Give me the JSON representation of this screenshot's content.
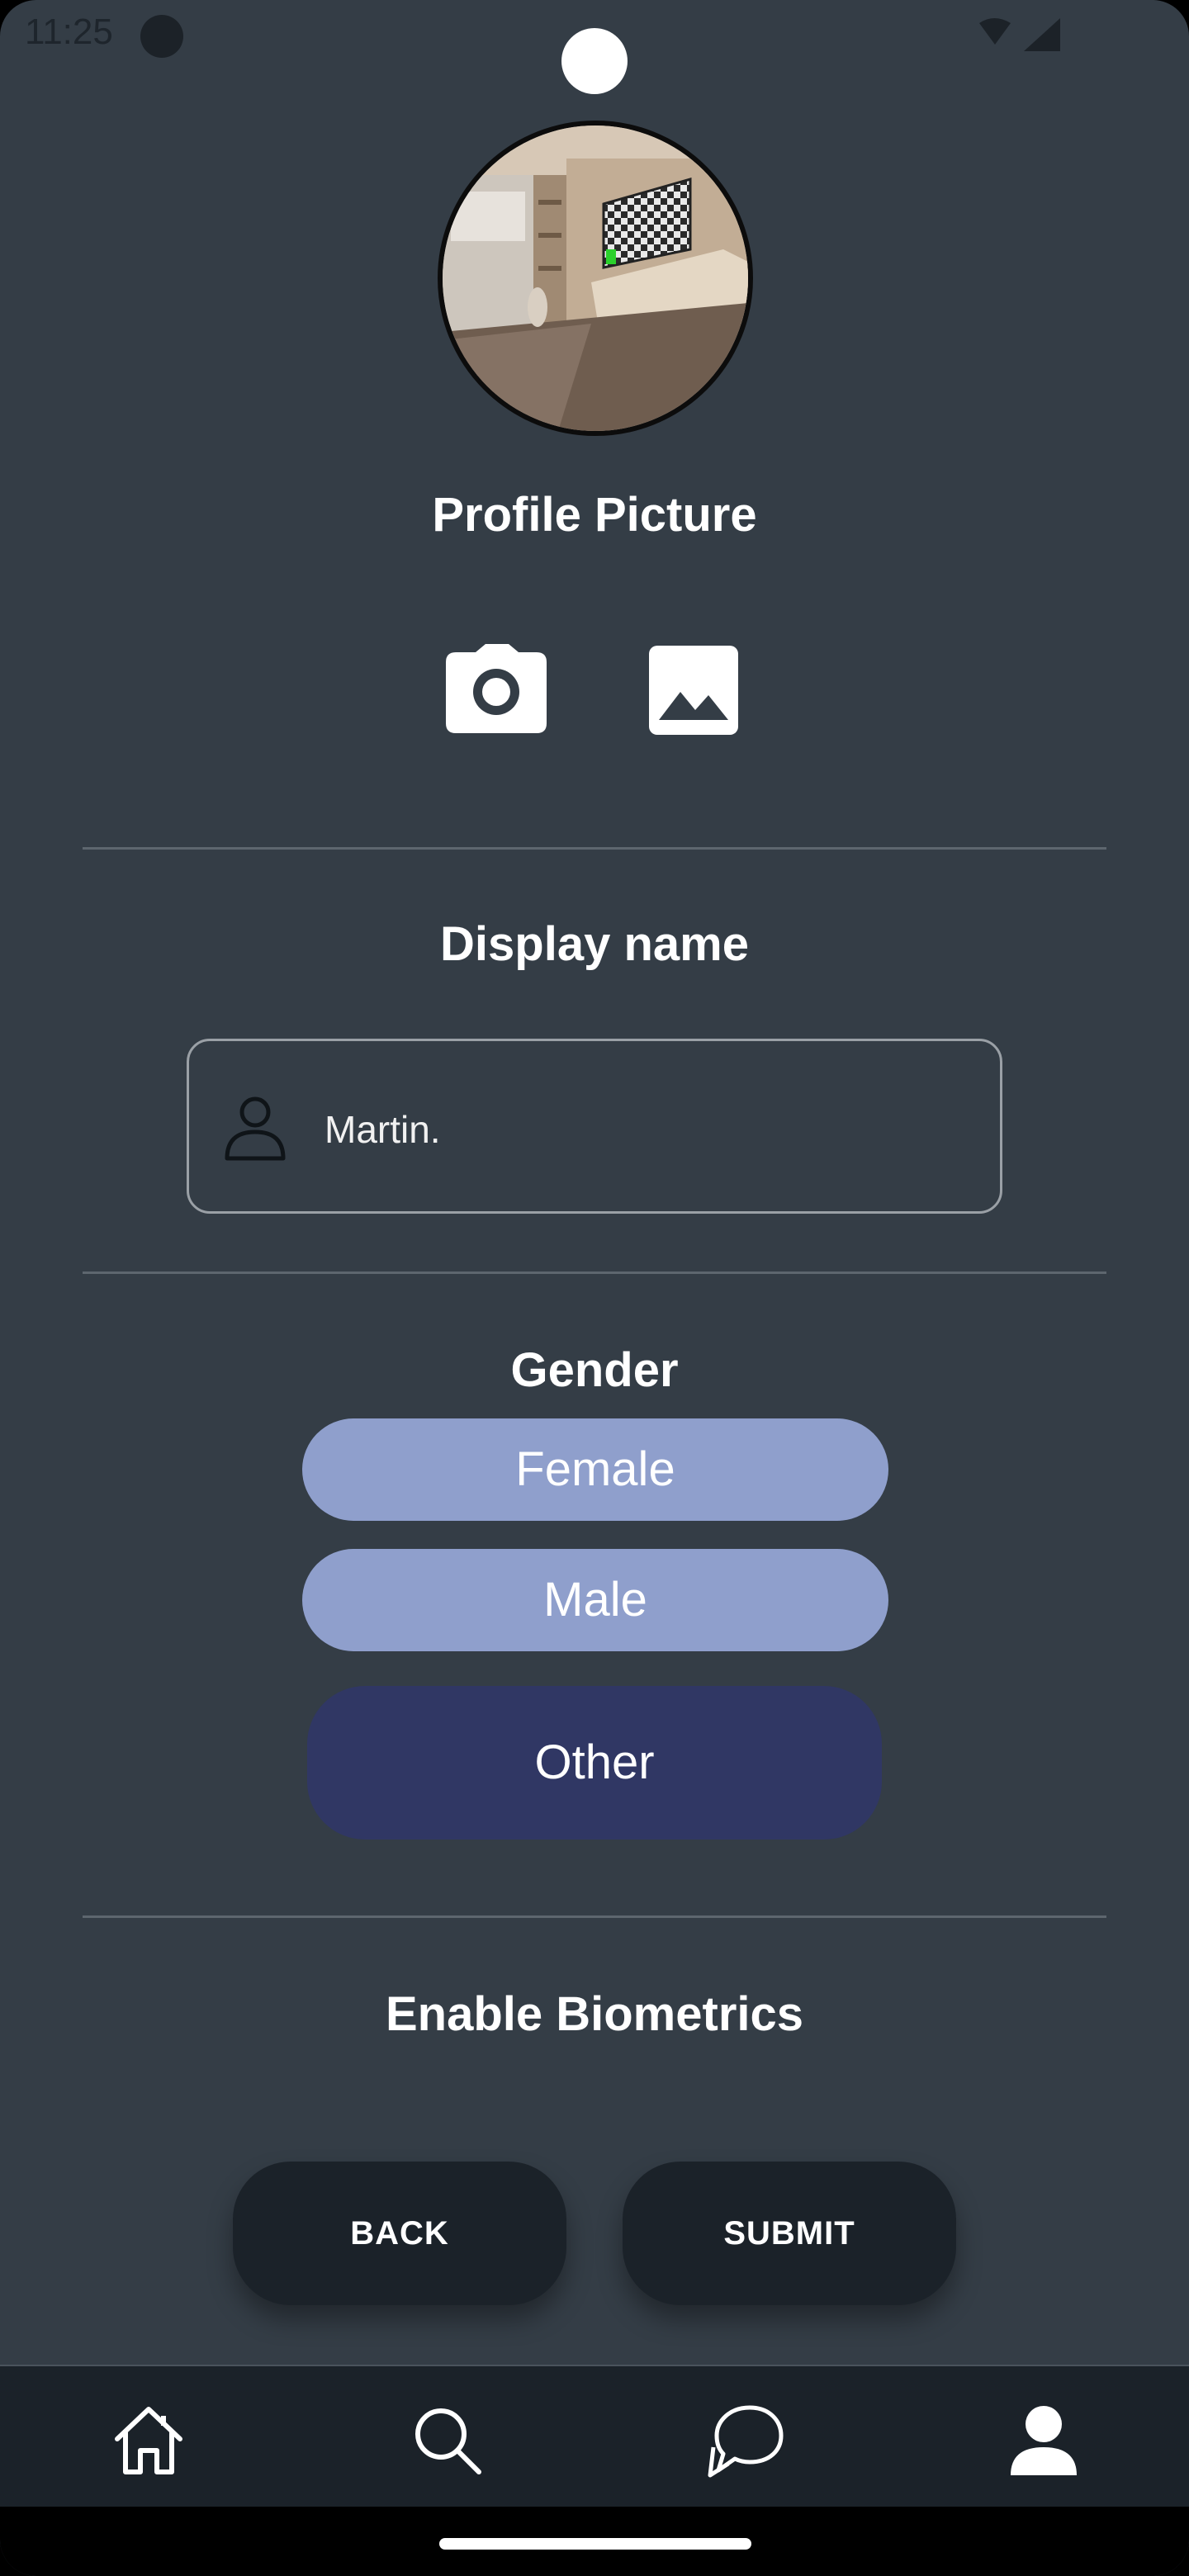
{
  "status_bar": {
    "time": "11:25"
  },
  "profile": {
    "picture_title": "Profile Picture",
    "camera_icon": "camera-icon",
    "gallery_icon": "image-gallery-icon"
  },
  "display_name": {
    "title": "Display name",
    "value": "Martin.",
    "icon": "person-outline-icon"
  },
  "gender": {
    "title": "Gender",
    "options": [
      "Female",
      "Male",
      "Other"
    ],
    "selected": "Other"
  },
  "biometrics": {
    "title": "Enable Biometrics"
  },
  "actions": {
    "back_label": "BACK",
    "submit_label": "SUBMIT"
  },
  "bottom_nav": {
    "items": [
      "home-icon",
      "search-icon",
      "chat-icon",
      "profile-icon"
    ],
    "active": "profile-icon"
  },
  "colors": {
    "background": "#343d46",
    "pill": "#8f9fcc",
    "pill_selected": "#303764",
    "action_button": "#1b2229",
    "nav_bar": "#1b2229"
  }
}
